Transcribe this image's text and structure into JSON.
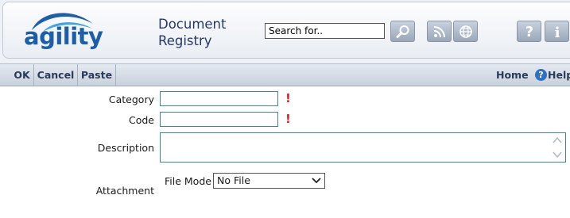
{
  "header": {
    "logo_text": "agility",
    "app_title_line1": "Document",
    "app_title_line2": "Registry",
    "search_value": "Search for..",
    "icons": [
      "search-icon",
      "rss-icon",
      "globe-icon",
      "help-icon",
      "info-icon"
    ]
  },
  "toolbar": {
    "ok_label": "OK",
    "cancel_label": "Cancel",
    "paste_label": "Paste",
    "home_label": "Home",
    "help_label": "Help",
    "help_glyph": "?"
  },
  "form": {
    "category_label": "Category",
    "code_label": "Code",
    "description_label": "Description",
    "attachment_label": "Attachment",
    "file_mode_label": "File Mode",
    "file_mode_value": "No File",
    "required_marker": "!"
  },
  "colors": {
    "brand_blue": "#1d5ea8",
    "required_red": "#e02020",
    "field_border": "#3a8a8a"
  }
}
